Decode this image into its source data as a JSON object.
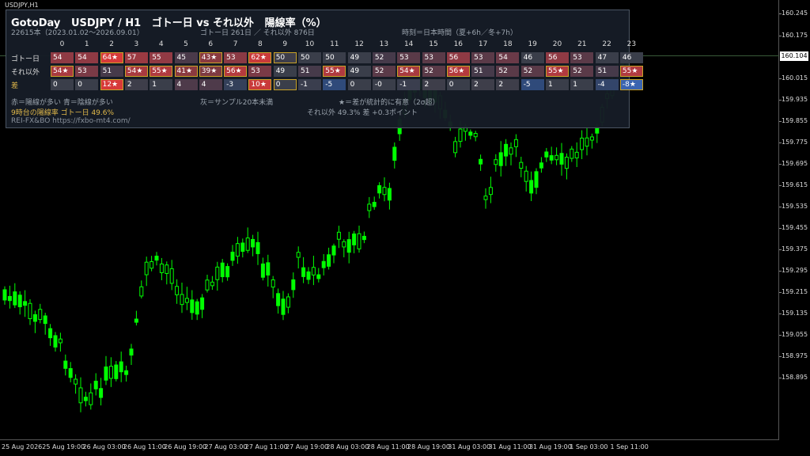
{
  "chart": {
    "symbol": "USDJPY,H1",
    "current_price": "160.104",
    "price_ticks": [
      "160.245",
      "160.175",
      "160.015",
      "159.935",
      "159.855",
      "159.775",
      "159.695",
      "159.615",
      "159.535",
      "159.455",
      "159.375",
      "159.295",
      "159.215",
      "159.135",
      "159.055",
      "158.975",
      "158.895"
    ],
    "time_ticks": [
      "25 Aug 2026",
      "25 Aug 19:00",
      "26 Aug 03:00",
      "26 Aug 11:00",
      "26 Aug 19:00",
      "27 Aug 03:00",
      "27 Aug 11:00",
      "27 Aug 19:00",
      "28 Aug 03:00",
      "28 Aug 11:00",
      "28 Aug 19:00",
      "31 Aug 03:00",
      "31 Aug 11:00",
      "31 Aug 19:00",
      "1 Sep 03:00",
      "1 Sep 11:00"
    ],
    "candle_color": "#00ff00"
  },
  "panel": {
    "title": "GotoDay   USDJPY / H1   ゴトー日 vs それ以外   陽線率（%）",
    "bar_count": "22615本（2023.01.02〜2026.09.01）",
    "sample_info": "ゴトー日 261日 ／ それ以外 876日",
    "timezone": "時刻＝日本時間（夏+6h／冬+7h）",
    "hours": [
      "0",
      "1",
      "2",
      "3",
      "4",
      "5",
      "6",
      "7",
      "8",
      "9",
      "10",
      "11",
      "12",
      "13",
      "14",
      "15",
      "16",
      "17",
      "18",
      "19",
      "20",
      "21",
      "22",
      "23"
    ],
    "rows": [
      {
        "label": "ゴトー日",
        "color": "#dddddd",
        "cells": [
          {
            "v": "54",
            "bg": "#8f3a44"
          },
          {
            "v": "54",
            "bg": "#8f3a44"
          },
          {
            "v": "64★",
            "bg": "#d73a3a",
            "hl": true
          },
          {
            "v": "57",
            "bg": "#9b3a42"
          },
          {
            "v": "55",
            "bg": "#923a44"
          },
          {
            "v": "45",
            "bg": "#4a3a4a"
          },
          {
            "v": "43★",
            "bg": "#8a3a40",
            "hl": true
          },
          {
            "v": "53",
            "bg": "#8a3a44"
          },
          {
            "v": "62★",
            "bg": "#c93a3a",
            "hl": true
          },
          {
            "v": "50",
            "bg": "#3e3e4a",
            "hl": true
          },
          {
            "v": "50",
            "bg": "#3a3e4a"
          },
          {
            "v": "50",
            "bg": "#3a3e4a"
          },
          {
            "v": "49",
            "bg": "#3a3e4a"
          },
          {
            "v": "52",
            "bg": "#463a4a"
          },
          {
            "v": "53",
            "bg": "#5a3a48"
          },
          {
            "v": "53",
            "bg": "#5a3a48"
          },
          {
            "v": "56",
            "bg": "#8f3a44"
          },
          {
            "v": "53",
            "bg": "#5a3a48"
          },
          {
            "v": "54",
            "bg": "#6a3a48"
          },
          {
            "v": "46",
            "bg": "#3a3e4a"
          },
          {
            "v": "56",
            "bg": "#8f3a44"
          },
          {
            "v": "53",
            "bg": "#5a3a48"
          },
          {
            "v": "47",
            "bg": "#3a3e4a"
          },
          {
            "v": "46",
            "bg": "#3a3e4a"
          }
        ]
      },
      {
        "label": "それ以外",
        "color": "#dddddd",
        "cells": [
          {
            "v": "54★",
            "bg": "#a83a40",
            "hl": true
          },
          {
            "v": "53",
            "bg": "#7a3a46"
          },
          {
            "v": "51",
            "bg": "#463a4a"
          },
          {
            "v": "54★",
            "bg": "#a83a40",
            "hl": true
          },
          {
            "v": "55★",
            "bg": "#b03a40",
            "hl": true
          },
          {
            "v": "41★",
            "bg": "#8a3a40",
            "hl": true
          },
          {
            "v": "39★",
            "bg": "#7e3a42",
            "hl": true
          },
          {
            "v": "56★",
            "bg": "#b43a3e",
            "hl": true
          },
          {
            "v": "53",
            "bg": "#7a3a46"
          },
          {
            "v": "49",
            "bg": "#3a3e4a"
          },
          {
            "v": "51",
            "bg": "#463a4a"
          },
          {
            "v": "55★",
            "bg": "#b03a40",
            "hl": true
          },
          {
            "v": "49",
            "bg": "#3a3e4a"
          },
          {
            "v": "52",
            "bg": "#5a3a48"
          },
          {
            "v": "54★",
            "bg": "#a83a40",
            "hl": true
          },
          {
            "v": "52",
            "bg": "#5a3a48"
          },
          {
            "v": "56★",
            "bg": "#b43a3e",
            "hl": true
          },
          {
            "v": "51",
            "bg": "#463a4a"
          },
          {
            "v": "52",
            "bg": "#5a3a48"
          },
          {
            "v": "52",
            "bg": "#5a3a48"
          },
          {
            "v": "55★",
            "bg": "#b03a40",
            "hl": true
          },
          {
            "v": "52",
            "bg": "#5a3a48"
          },
          {
            "v": "51",
            "bg": "#463a4a"
          },
          {
            "v": "55★",
            "bg": "#b03a40",
            "hl": true
          }
        ]
      },
      {
        "label": "差",
        "color": "#e0b84a",
        "cells": [
          {
            "v": "0",
            "bg": "#3a3e4a"
          },
          {
            "v": "0",
            "bg": "#3a3e4a"
          },
          {
            "v": "12★",
            "bg": "#d73a3a",
            "hl": true
          },
          {
            "v": "2",
            "bg": "#3e3e4a"
          },
          {
            "v": "1",
            "bg": "#3a3e4a"
          },
          {
            "v": "4",
            "bg": "#4e3a4a"
          },
          {
            "v": "4",
            "bg": "#4e3a4a"
          },
          {
            "v": "-3",
            "bg": "#34405a"
          },
          {
            "v": "10★",
            "bg": "#c93a3a",
            "hl": true
          },
          {
            "v": "0",
            "bg": "#3a3e4a",
            "hl": true
          },
          {
            "v": "-1",
            "bg": "#3a3e4e"
          },
          {
            "v": "-5",
            "bg": "#2f4a7a"
          },
          {
            "v": "0",
            "bg": "#3a3e4a"
          },
          {
            "v": "-0",
            "bg": "#3a3e4a"
          },
          {
            "v": "-1",
            "bg": "#3a3e4e"
          },
          {
            "v": "2",
            "bg": "#3e3e4a"
          },
          {
            "v": "0",
            "bg": "#3a3e4a"
          },
          {
            "v": "2",
            "bg": "#3e3e4a"
          },
          {
            "v": "2",
            "bg": "#3e3e4a"
          },
          {
            "v": "-5",
            "bg": "#2f4a7a"
          },
          {
            "v": "1",
            "bg": "#3a3e4a"
          },
          {
            "v": "1",
            "bg": "#3a3e4a"
          },
          {
            "v": "-4",
            "bg": "#33456a"
          },
          {
            "v": "-8★",
            "bg": "#3a64b0",
            "hl": true
          }
        ]
      }
    ],
    "legend_color": "赤＝陽線が多い  青＝陰線が多い",
    "legend_gray": "灰＝サンプル20本未満",
    "legend_star": "★＝差が統計的に有意（2σ超）",
    "highlight_hour": "9時台の陽線率  ゴトー日 49.6%",
    "highlight_other": "それ以外 49.3%  差 +0.3ポイント",
    "footer": "REI-FX&BO   https://fxbo-mt4.com/"
  }
}
